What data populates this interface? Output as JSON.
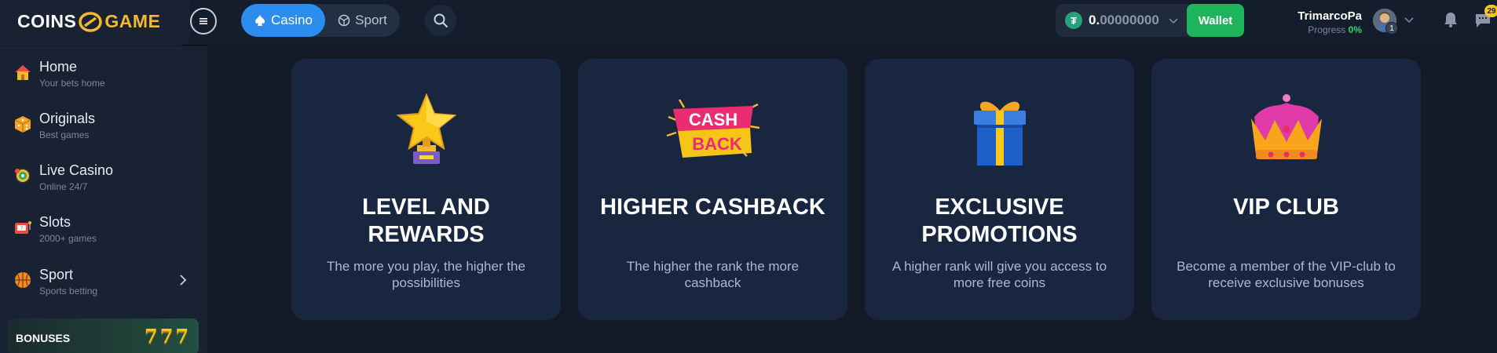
{
  "header": {
    "logo_left": "COINS",
    "logo_right": "GAME",
    "modes": {
      "casino": "Casino",
      "sport": "Sport"
    },
    "balance": {
      "int": "0.",
      "frac": "00000000",
      "currency_icon": "tether-icon"
    },
    "wallet_label": "Wallet",
    "user": {
      "name": "TrimarcoPa",
      "progress_label": "Progress",
      "progress_value": "0%",
      "level_badge": "1"
    },
    "chat_badge": "29"
  },
  "sidebar": {
    "items": [
      {
        "title": "Home",
        "subtitle": "Your bets home",
        "icon": "home-icon"
      },
      {
        "title": "Originals",
        "subtitle": "Best games",
        "icon": "dice-icon"
      },
      {
        "title": "Live Casino",
        "subtitle": "Online 24/7",
        "icon": "roulette-icon"
      },
      {
        "title": "Slots",
        "subtitle": "2000+ games",
        "icon": "slot-machine-icon"
      },
      {
        "title": "Sport",
        "subtitle": "Sports betting",
        "icon": "basketball-icon"
      }
    ],
    "bonuses_label": "BONUSES",
    "bonuses_art": "777"
  },
  "cards": [
    {
      "title_line1": "LEVEL AND",
      "title_line2": "REWARDS",
      "desc_line1": "The more you play, the higher the",
      "desc_line2": "possibilities",
      "icon": "star-trophy-icon"
    },
    {
      "title_line1": "HIGHER CASHBACK",
      "title_line2": "",
      "desc_line1": "The higher the rank the more",
      "desc_line2": "cashback",
      "icon": "cashback-icon",
      "icon_text1": "CASH",
      "icon_text2": "BACK"
    },
    {
      "title_line1": "EXCLUSIVE",
      "title_line2": "PROMOTIONS",
      "desc_line1": "A higher rank will give you access to",
      "desc_line2": "more free coins",
      "icon": "gift-box-icon"
    },
    {
      "title_line1": "VIP CLUB",
      "title_line2": "",
      "desc_line1": "Become a member of the VIP-club to",
      "desc_line2": "receive exclusive bonuses",
      "icon": "crown-icon"
    }
  ],
  "colors": {
    "accent": "#2d8cf0",
    "wallet": "#1eb45b",
    "gold": "#f5b82e",
    "card": "#192640",
    "bg": "#121a27"
  }
}
